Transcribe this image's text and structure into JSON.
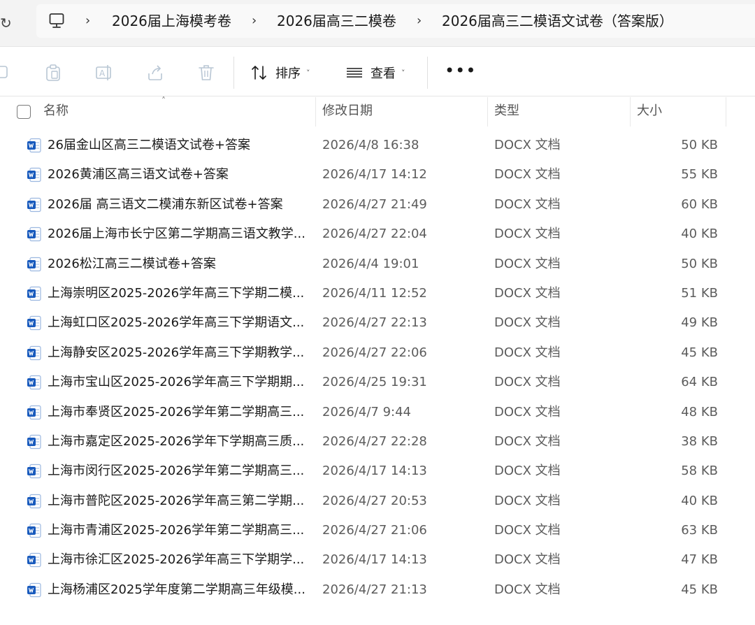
{
  "address": {
    "breadcrumbs": [
      "2026届上海模考卷",
      "2026届高三二模卷",
      "2026届高三二模语文试卷（答案版）"
    ]
  },
  "toolbar": {
    "sort_label": "排序",
    "view_label": "查看",
    "more_label": "•••"
  },
  "columns": {
    "name": "名称",
    "modified": "修改日期",
    "type": "类型",
    "size": "大小"
  },
  "files": [
    {
      "name": "26届金山区高三二模语文试卷+答案",
      "modified": "2026/4/8 16:38",
      "type": "DOCX 文档",
      "size": "50 KB"
    },
    {
      "name": "2026黄浦区高三语文试卷+答案",
      "modified": "2026/4/17 14:12",
      "type": "DOCX 文档",
      "size": "55 KB"
    },
    {
      "name": "2026届 高三语文二模浦东新区试卷+答案",
      "modified": "2026/4/27 21:49",
      "type": "DOCX 文档",
      "size": "60 KB"
    },
    {
      "name": "2026届上海市长宁区第二学期高三语文教学...",
      "modified": "2026/4/27 22:04",
      "type": "DOCX 文档",
      "size": "40 KB"
    },
    {
      "name": "2026松江高三二模试卷+答案",
      "modified": "2026/4/4 19:01",
      "type": "DOCX 文档",
      "size": "50 KB"
    },
    {
      "name": "上海崇明区2025-2026学年高三下学期二模...",
      "modified": "2026/4/11 12:52",
      "type": "DOCX 文档",
      "size": "51 KB"
    },
    {
      "name": "上海虹口区2025-2026学年高三下学期语文...",
      "modified": "2026/4/27 22:13",
      "type": "DOCX 文档",
      "size": "49 KB"
    },
    {
      "name": "上海静安区2025-2026学年高三下学期教学...",
      "modified": "2026/4/27 22:06",
      "type": "DOCX 文档",
      "size": "45 KB"
    },
    {
      "name": "上海市宝山区2025-2026学年高三下学期期...",
      "modified": "2026/4/25 19:31",
      "type": "DOCX 文档",
      "size": "64 KB"
    },
    {
      "name": "上海市奉贤区2025-2026学年第二学期高三...",
      "modified": "2026/4/7 9:44",
      "type": "DOCX 文档",
      "size": "48 KB"
    },
    {
      "name": "上海市嘉定区2025-2026学年下学期高三质...",
      "modified": "2026/4/27 22:28",
      "type": "DOCX 文档",
      "size": "38 KB"
    },
    {
      "name": "上海市闵行区2025-2026学年第二学期高三...",
      "modified": "2026/4/17 14:13",
      "type": "DOCX 文档",
      "size": "58 KB"
    },
    {
      "name": "上海市普陀区2025-2026学年高三第二学期...",
      "modified": "2026/4/27 20:53",
      "type": "DOCX 文档",
      "size": "40 KB"
    },
    {
      "name": "上海市青浦区2025-2026学年第二学期高三...",
      "modified": "2026/4/27 21:06",
      "type": "DOCX 文档",
      "size": "63 KB"
    },
    {
      "name": "上海市徐汇区2025-2026学年高三下学期学...",
      "modified": "2026/4/17 14:13",
      "type": "DOCX 文档",
      "size": "47 KB"
    },
    {
      "name": "上海杨浦区2025学年度第二学期高三年级模...",
      "modified": "2026/4/27 21:13",
      "type": "DOCX 文档",
      "size": "45 KB"
    }
  ]
}
